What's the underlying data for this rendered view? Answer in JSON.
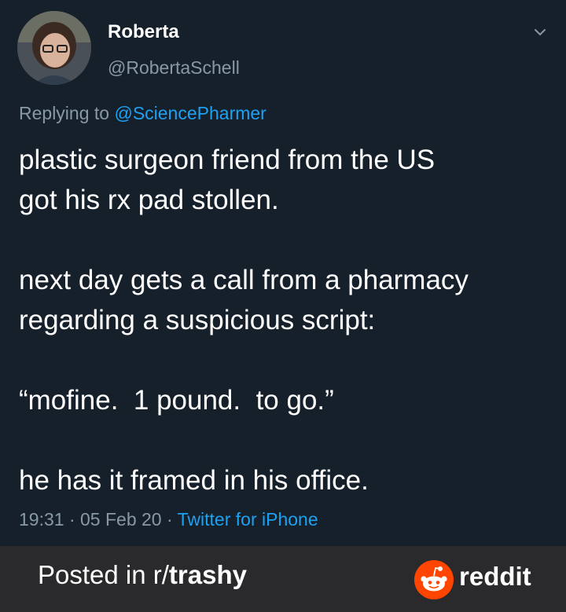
{
  "tweet": {
    "author_name": "Roberta",
    "author_handle": "@RobertaSchell",
    "reply_prefix": "Replying to",
    "reply_to": "@SciencePharmer",
    "lines": [
      "plastic surgeon friend from the US",
      "got his rx pad stollen.",
      "next day gets a call from a pharmacy",
      "regarding a suspicious script:",
      "“mofine.  1 pound.  to go.”",
      "he has it framed in his office."
    ],
    "time": "19:31",
    "date": "05 Feb 20",
    "sep": " · ",
    "source": "Twitter for iPhone"
  },
  "footer": {
    "posted_prefix": "Posted in r/",
    "subreddit": "trashy",
    "brand": "reddit"
  },
  "icons": {
    "menu": "chevron-down-icon",
    "brand_logo": "reddit-logo-icon"
  },
  "colors": {
    "background": "#15202b",
    "secondary_text": "#8899a6",
    "link": "#1da1f2",
    "footer_bg": "#2a2a2c",
    "reddit_orange": "#ff4500"
  }
}
